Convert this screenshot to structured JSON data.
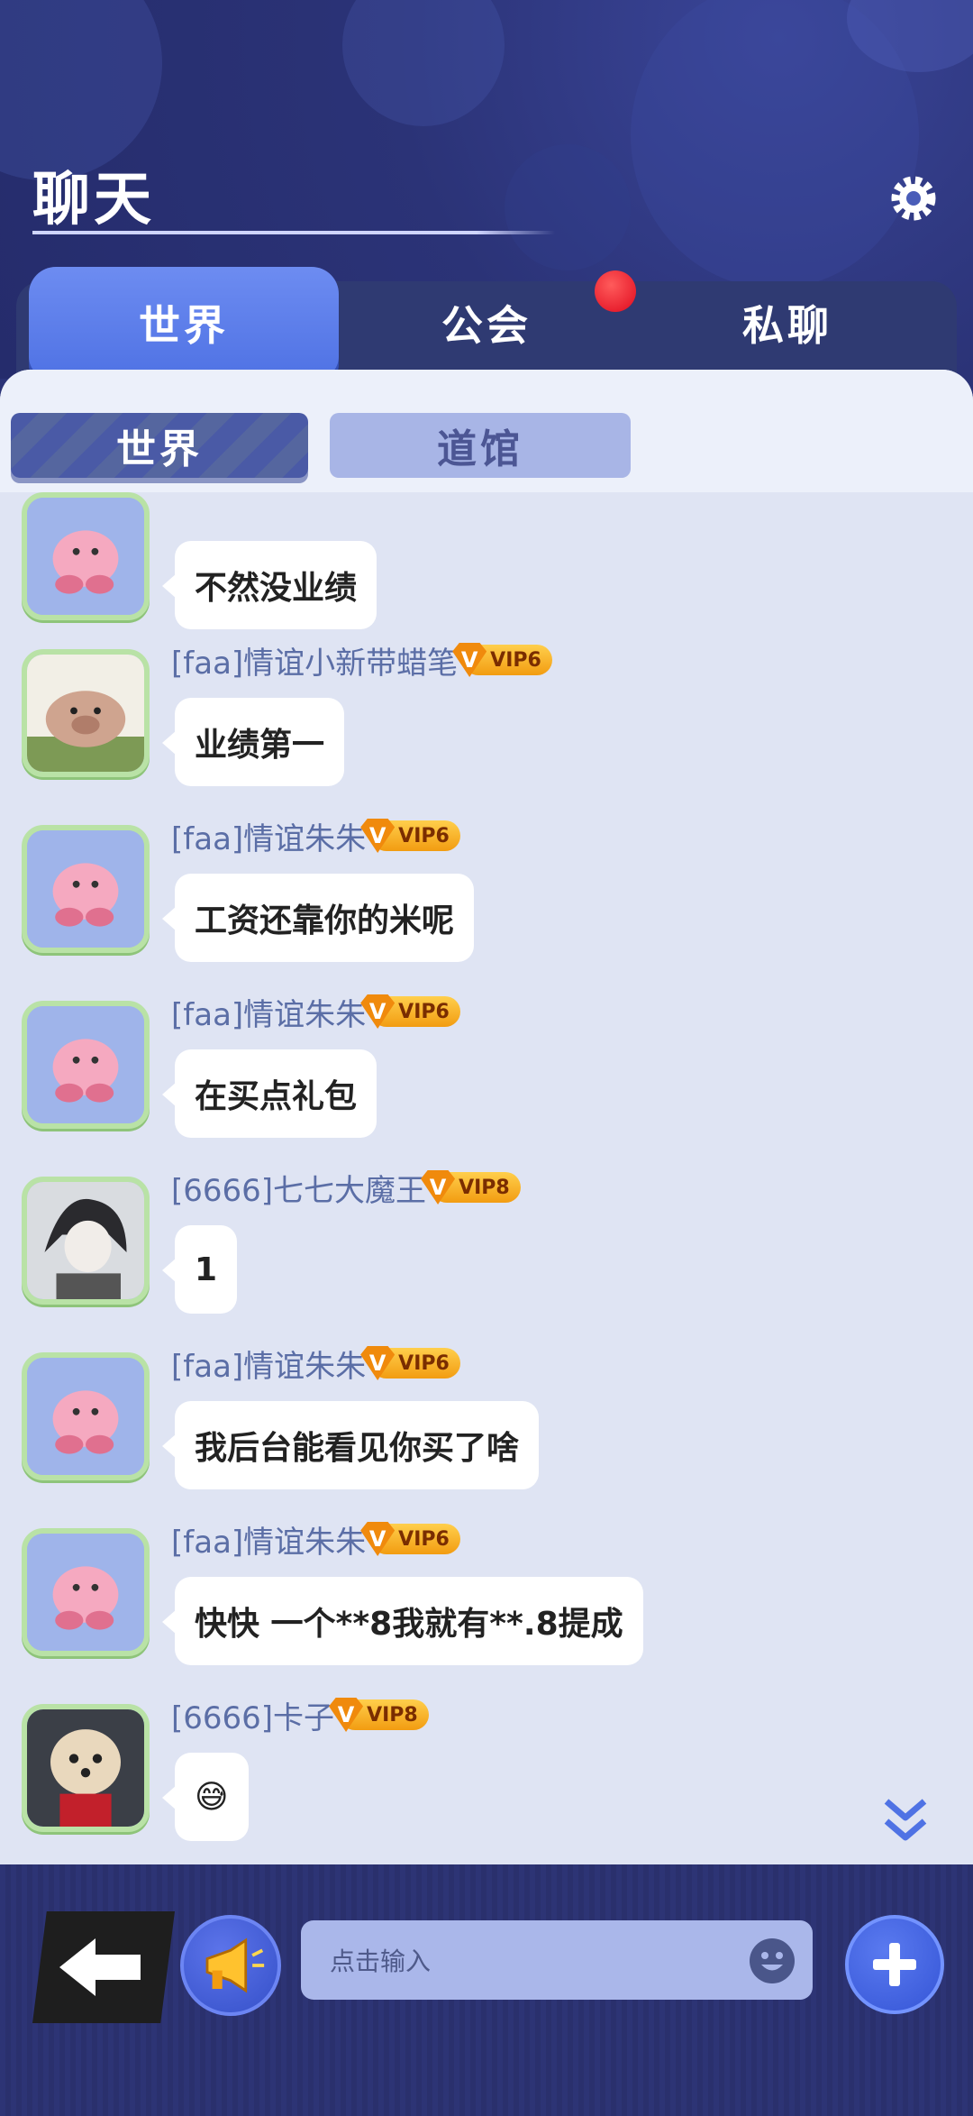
{
  "header": {
    "title": "聊天",
    "settings_icon": "gear-icon"
  },
  "tabs": [
    {
      "label": "世界",
      "active": true
    },
    {
      "label": "公会",
      "active": false,
      "badge": true
    },
    {
      "label": "私聊",
      "active": false
    }
  ],
  "subtabs": [
    {
      "label": "世界",
      "active": true
    },
    {
      "label": "道馆",
      "active": false
    }
  ],
  "messages": [
    {
      "user": "",
      "vip": "",
      "text": "不然没业绩",
      "avatar": "pink-blob-avatar"
    },
    {
      "user": "[faa]情谊小新带蜡笔",
      "vip": "VIP6",
      "text": "业绩第一",
      "avatar": "plush-pig-avatar"
    },
    {
      "user": "[faa]情谊朱朱",
      "vip": "VIP6",
      "text": "工资还靠你的米呢",
      "avatar": "pink-blob-avatar"
    },
    {
      "user": "[faa]情谊朱朱",
      "vip": "VIP6",
      "text": "在买点礼包",
      "avatar": "pink-blob-avatar"
    },
    {
      "user": "[6666]七七大魔王",
      "vip": "VIP8",
      "text": "1",
      "avatar": "anime-boy-avatar"
    },
    {
      "user": "[faa]情谊朱朱",
      "vip": "VIP6",
      "text": "我后台能看见你买了啥",
      "avatar": "pink-blob-avatar"
    },
    {
      "user": "[faa]情谊朱朱",
      "vip": "VIP6",
      "text": "快快 一个**8我就有**.8提成",
      "avatar": "pink-blob-avatar"
    },
    {
      "user": "[6666]卡子",
      "vip": "VIP8",
      "text": "😅",
      "avatar": "dog-avatar"
    }
  ],
  "vip_badge_letter": "V",
  "input": {
    "placeholder": "点击输入",
    "value": ""
  },
  "colors": {
    "accent": "#4f72e4",
    "panel": "#dfe4f3",
    "vip": "#f29c11",
    "badge": "#e00a1e"
  }
}
